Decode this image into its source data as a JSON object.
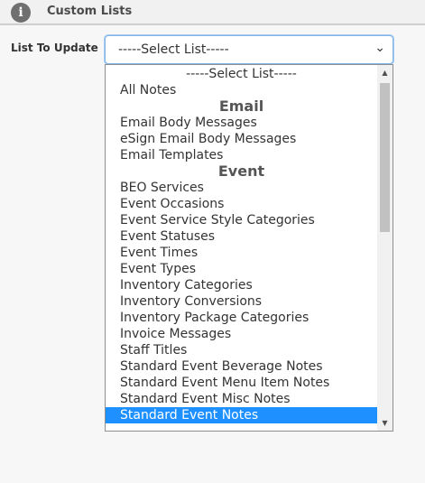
{
  "header": {
    "icon": "info-icon",
    "title": "Custom Lists"
  },
  "form": {
    "label": "List To Update",
    "select_value": "-----Select List-----",
    "chevron": "⌄"
  },
  "dropdown": {
    "items": [
      {
        "text": "-----Select List-----",
        "kind": "option-center"
      },
      {
        "text": "All Notes",
        "kind": "option"
      },
      {
        "text": "Email",
        "kind": "group"
      },
      {
        "text": "Email Body Messages",
        "kind": "option"
      },
      {
        "text": "eSign Email Body Messages",
        "kind": "option"
      },
      {
        "text": "Email Templates",
        "kind": "option"
      },
      {
        "text": "Event",
        "kind": "group"
      },
      {
        "text": "BEO Services",
        "kind": "option"
      },
      {
        "text": "Event Occasions",
        "kind": "option"
      },
      {
        "text": "Event Service Style Categories",
        "kind": "option"
      },
      {
        "text": "Event Statuses",
        "kind": "option"
      },
      {
        "text": "Event Times",
        "kind": "option"
      },
      {
        "text": "Event Types",
        "kind": "option"
      },
      {
        "text": "Inventory Categories",
        "kind": "option"
      },
      {
        "text": "Inventory Conversions",
        "kind": "option"
      },
      {
        "text": "Inventory Package Categories",
        "kind": "option"
      },
      {
        "text": "Invoice Messages",
        "kind": "option"
      },
      {
        "text": "Staff Titles",
        "kind": "option"
      },
      {
        "text": "Standard Event Beverage Notes",
        "kind": "option"
      },
      {
        "text": "Standard Event Menu Item Notes",
        "kind": "option"
      },
      {
        "text": "Standard Event Misc Notes",
        "kind": "option"
      },
      {
        "text": "Standard Event Notes",
        "kind": "option-highlighted"
      }
    ],
    "highlight_color": "#1e90ff",
    "scroll_up": "▲",
    "scroll_down": "▼"
  }
}
